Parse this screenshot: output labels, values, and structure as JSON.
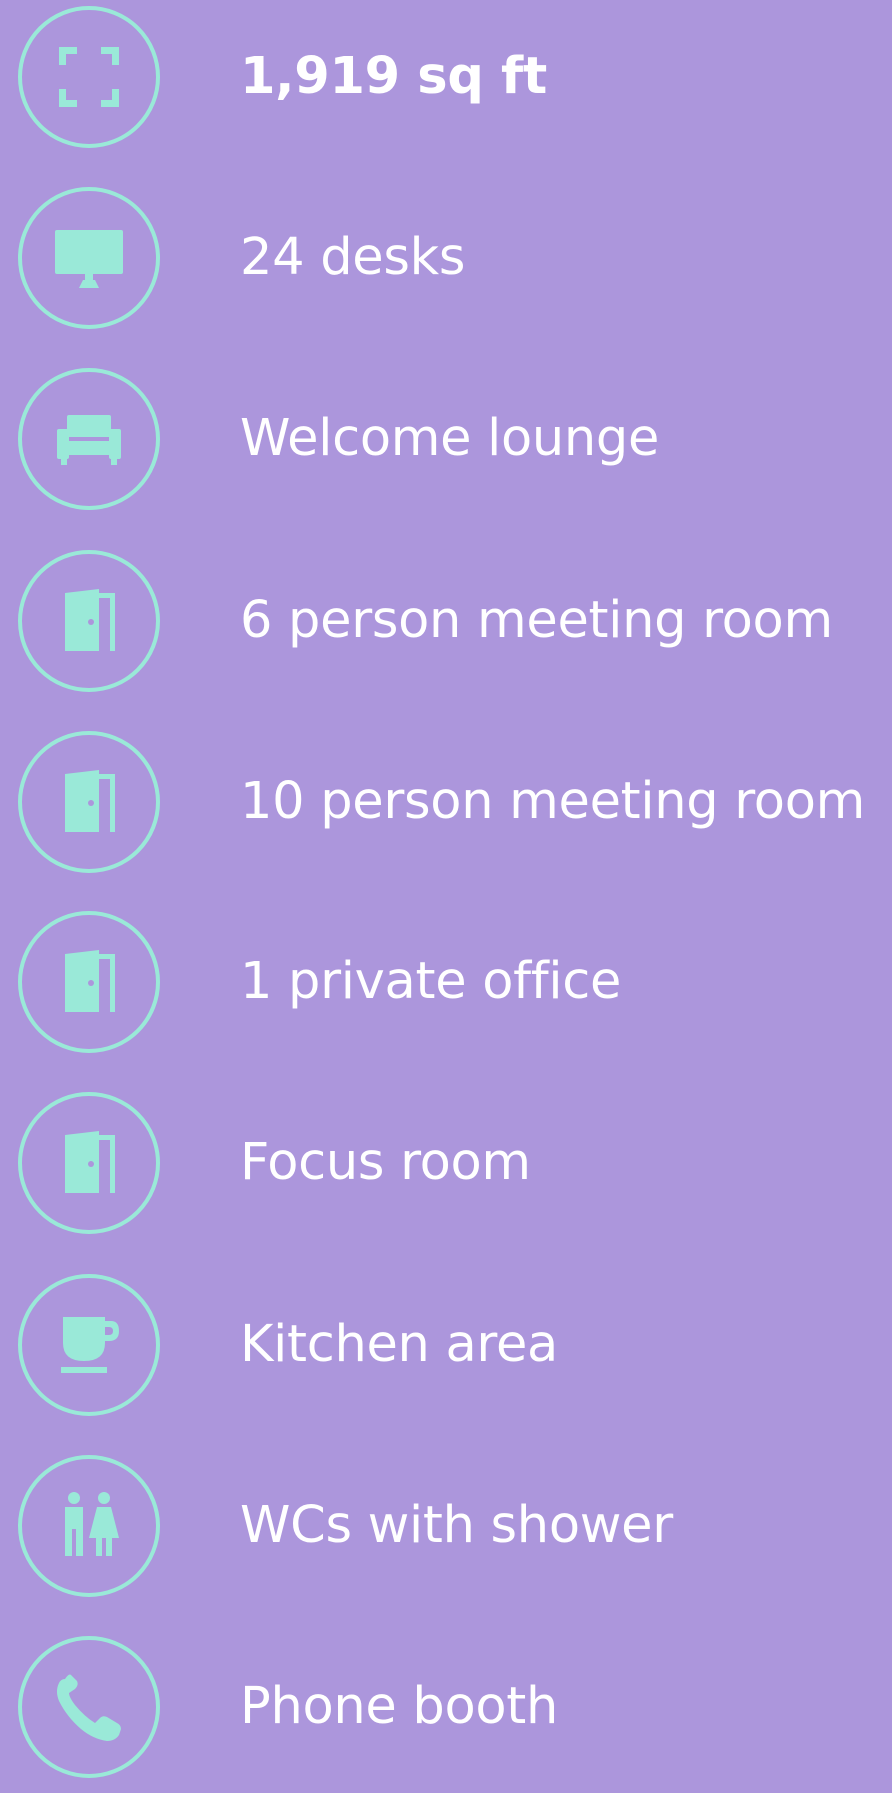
{
  "colors": {
    "background": "#ac96dc",
    "accent": "#9ae9d8",
    "text": "#ffffff"
  },
  "features": [
    {
      "icon": "expand-icon",
      "label": "1,919 sq ft"
    },
    {
      "icon": "monitor-icon",
      "label": "24 desks"
    },
    {
      "icon": "sofa-icon",
      "label": "Welcome lounge"
    },
    {
      "icon": "door-icon",
      "label": "6 person meeting room"
    },
    {
      "icon": "door-icon",
      "label": "10 person meeting room"
    },
    {
      "icon": "door-icon",
      "label": "1 private office"
    },
    {
      "icon": "door-icon",
      "label": "Focus room"
    },
    {
      "icon": "cup-icon",
      "label": "Kitchen area"
    },
    {
      "icon": "restroom-icon",
      "label": "WCs with shower"
    },
    {
      "icon": "phone-icon",
      "label": "Phone booth"
    }
  ]
}
